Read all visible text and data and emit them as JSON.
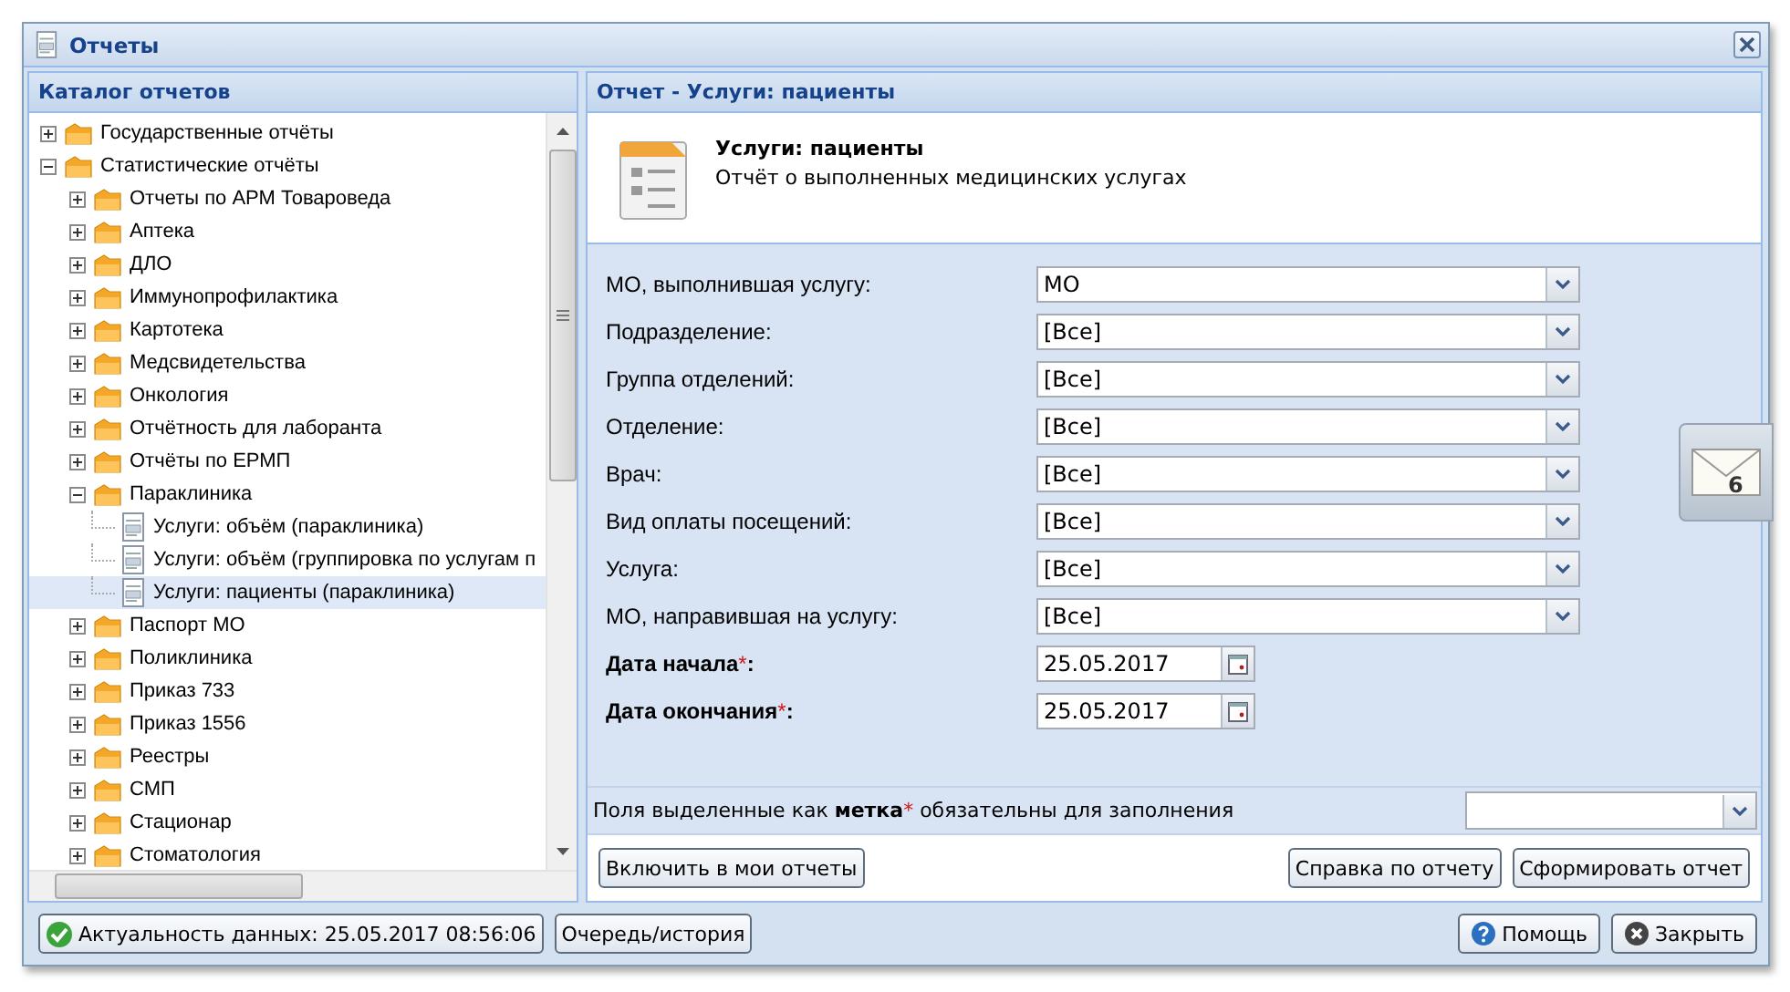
{
  "window": {
    "title": "Отчеты"
  },
  "catalog": {
    "title": "Каталог отчетов",
    "tree": [
      {
        "kind": "folder",
        "label": "Государственные отчёты",
        "expanded": false
      },
      {
        "kind": "folder",
        "label": "Статистические отчёты",
        "expanded": true,
        "children": [
          {
            "kind": "folder",
            "label": "Отчеты по АРМ Товароведа",
            "expanded": false
          },
          {
            "kind": "folder",
            "label": "Аптека",
            "expanded": false
          },
          {
            "kind": "folder",
            "label": "ДЛО",
            "expanded": false
          },
          {
            "kind": "folder",
            "label": "Иммунопрофилактика",
            "expanded": false
          },
          {
            "kind": "folder",
            "label": "Картотека",
            "expanded": false
          },
          {
            "kind": "folder",
            "label": "Медсвидетельства",
            "expanded": false
          },
          {
            "kind": "folder",
            "label": "Онкология",
            "expanded": false
          },
          {
            "kind": "folder",
            "label": "Отчётность для лаборанта",
            "expanded": false
          },
          {
            "kind": "folder",
            "label": "Отчёты по ЕРМП",
            "expanded": false
          },
          {
            "kind": "folder",
            "label": "Параклиника",
            "expanded": true,
            "children": [
              {
                "kind": "report",
                "label": "Услуги: объём (параклиника)",
                "selected": false
              },
              {
                "kind": "report",
                "label": "Услуги: объём (группировка по услугам п",
                "selected": false
              },
              {
                "kind": "report",
                "label": "Услуги: пациенты (параклиника)",
                "selected": true
              }
            ]
          },
          {
            "kind": "folder",
            "label": "Паспорт МО",
            "expanded": false
          },
          {
            "kind": "folder",
            "label": "Поликлиника",
            "expanded": false
          },
          {
            "kind": "folder",
            "label": "Приказ 733",
            "expanded": false
          },
          {
            "kind": "folder",
            "label": "Приказ 1556",
            "expanded": false
          },
          {
            "kind": "folder",
            "label": "Реестры",
            "expanded": false
          },
          {
            "kind": "folder",
            "label": "СМП",
            "expanded": false
          },
          {
            "kind": "folder",
            "label": "Стационар",
            "expanded": false
          },
          {
            "kind": "folder",
            "label": "Стоматология",
            "expanded": false
          }
        ]
      }
    ]
  },
  "report": {
    "header": "Отчет - Услуги: пациенты",
    "name": "Услуги: пациенты",
    "description": "Отчёт о выполненных медицинских услугах",
    "fields": [
      {
        "kind": "combo",
        "label": "МО, выполнившая услугу:",
        "value": "МО",
        "required": false
      },
      {
        "kind": "combo",
        "label": "Подразделение:",
        "value": "[Все]",
        "required": false
      },
      {
        "kind": "combo",
        "label": "Группа отделений:",
        "value": "[Все]",
        "required": false
      },
      {
        "kind": "combo",
        "label": "Отделение:",
        "value": "[Все]",
        "required": false
      },
      {
        "kind": "combo",
        "label": "Врач:",
        "value": "[Все]",
        "required": false
      },
      {
        "kind": "combo",
        "label": "Вид оплаты посещений:",
        "value": "[Все]",
        "required": false
      },
      {
        "kind": "combo",
        "label": "Услуга:",
        "value": "[Все]",
        "required": false
      },
      {
        "kind": "combo",
        "label": "МО, направившая на услугу:",
        "value": "[Все]",
        "required": false
      },
      {
        "kind": "date",
        "label": "Дата начала",
        "required_mark": "*",
        "label_end": ":",
        "value": "25.05.2017",
        "required": true
      },
      {
        "kind": "date",
        "label": "Дата окончания",
        "required_mark": "*",
        "label_end": ":",
        "value": "25.05.2017",
        "required": true
      }
    ],
    "hint": {
      "before": "Поля выделенные как",
      "mark": "метка",
      "asterisk": "*",
      "after": "обязательны для заполнения"
    },
    "left_buttons": [
      "Включить в мои отчеты"
    ],
    "right_buttons": [
      "Справка по отчету",
      "Сформировать отчет"
    ]
  },
  "status": {
    "freshness": "Актуальность данных: 25.05.2017 08:56:06",
    "queue": "Очередь/история"
  },
  "footer_buttons": [
    {
      "kind": "help",
      "label": "Помощь"
    },
    {
      "kind": "close",
      "label": "Закрыть"
    }
  ],
  "notifications": {
    "count": "6"
  }
}
